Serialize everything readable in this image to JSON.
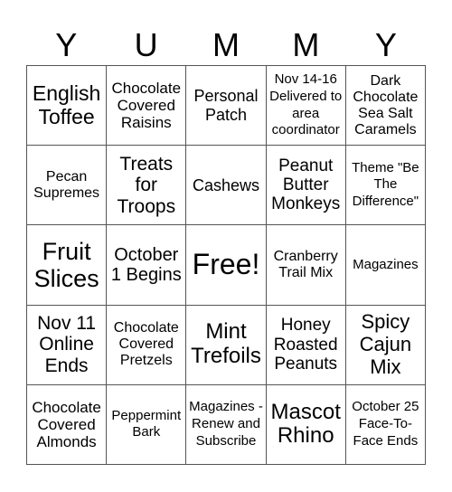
{
  "header": {
    "letters": [
      "Y",
      "U",
      "M",
      "M",
      "Y"
    ]
  },
  "cells": [
    "English Toffee",
    "Chocolate Covered Raisins",
    "Personal Patch",
    "Nov 14-16 Delivered to area coordinator",
    "Dark Chocolate Sea Salt Caramels",
    "Pecan Supremes",
    "Treats for Troops",
    "Cashews",
    "Peanut Butter Monkeys",
    "Theme \"Be The Difference\"",
    "Fruit Slices",
    "October 1 Begins",
    "Free!",
    "Cranberry Trail Mix",
    "Magazines",
    "Nov 11 Online Ends",
    "Chocolate Covered Pretzels",
    "Mint Trefoils",
    "Honey Roasted Peanuts",
    "Spicy Cajun Mix",
    "Chocolate Covered Almonds",
    "Peppermint Bark",
    "Magazines - Renew and Subscribe",
    "Mascot Rhino",
    "October 25 Face-To-Face Ends"
  ]
}
